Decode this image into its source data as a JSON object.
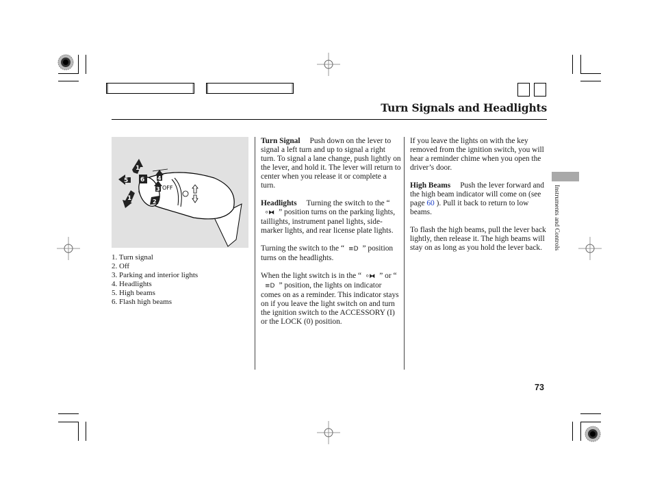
{
  "header": {
    "title": "Turn Signals and Headlights",
    "nav_boxes": [
      "",
      ""
    ],
    "square_boxes": [
      "",
      ""
    ]
  },
  "figure": {
    "description": "Turn signal / headlight combination lever illustration",
    "callouts": [
      "1",
      "1",
      "2",
      "3",
      "4",
      "5",
      "6"
    ],
    "switch_label": "OFF"
  },
  "legend": {
    "items": [
      "1. Turn signal",
      "2. Off",
      "3. Parking and interior lights",
      "4. Headlights",
      "5. High beams",
      "6. Flash high beams"
    ]
  },
  "column2": {
    "turn_signal": {
      "heading": "Turn Signal",
      "text": "Push down on the lever to signal a left turn and up to signal a right turn. To signal a lane change, push lightly on the lever, and hold it. The lever will return to center when you release it or complete a turn."
    },
    "headlights": {
      "heading": "Headlights",
      "text_before": "Turning the switch to the “",
      "symbol_parking": "parking-lights-icon",
      "text_after": "” position turns on the parking lights, taillights, instrument panel lights, side-marker lights, and rear license plate lights."
    },
    "headlights_on": {
      "text_before": "Turning the switch to the “",
      "symbol_headlight": "headlight-icon",
      "text_after": "” position turns on the headlights."
    },
    "indicator": {
      "text_before": "When the light switch is in the “",
      "text_middle": "” or “",
      "text_after": "” position, the lights on indicator comes on as a reminder. This indicator stays on if you leave the light switch on and turn the ignition switch to the ACCESSORY (I) or the LOCK (0) position."
    }
  },
  "column3": {
    "reminder": {
      "text": "If you leave the lights on with the key removed from the ignition switch, you will hear a reminder chime when you open the driver’s door."
    },
    "high_beams": {
      "heading": "High Beams",
      "text_before": "Push the lever forward and the high beam indicator will come on (see page ",
      "page_link": "60",
      "text_after": " ). Pull it back to return to low beams."
    },
    "flash": {
      "text": "To flash the high beams, pull the lever back lightly, then release it. The high beams will stay on as long as you hold the lever back."
    }
  },
  "side_tab": {
    "label": "Instruments and Controls",
    "color": "#a9a9a9"
  },
  "footer": {
    "page_number": "73"
  },
  "colors": {
    "link": "#1a3ec8",
    "figure_bg": "#e1e1e1"
  }
}
